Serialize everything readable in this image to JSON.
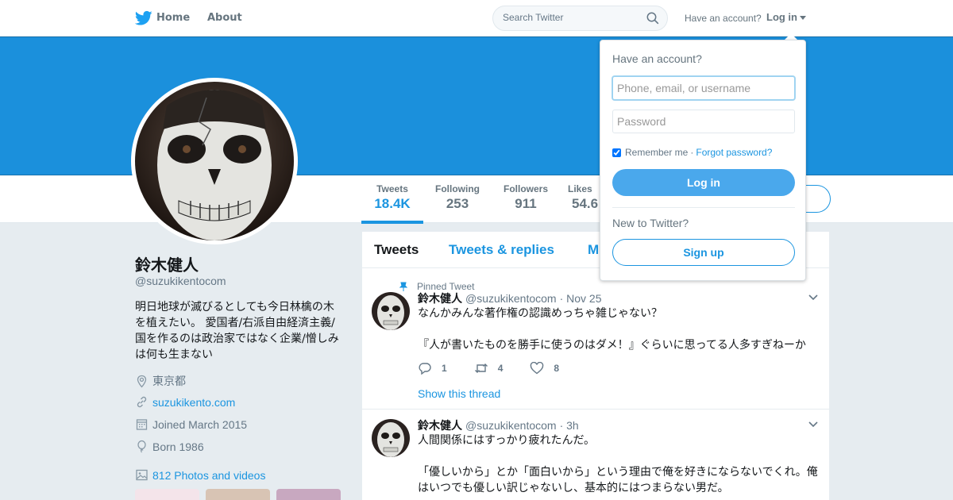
{
  "nav": {
    "home_label": "Home",
    "about_label": "About",
    "search_placeholder": "Search Twitter",
    "have_account": "Have an account?",
    "login_toggle": "Log in"
  },
  "profile": {
    "name": "鈴木健人",
    "handle": "@suzukikentocom",
    "bio": "明日地球が滅びるとしても今日林檎の木を植えたい。 愛国者/右派自由経済主義/国を作るのは政治家ではなく企業/憎しみは何も生まない",
    "location": "東京都",
    "website": "suzukikento.com",
    "joined": "Joined March 2015",
    "born": "Born 1986",
    "photos": "812 Photos and videos"
  },
  "stats": [
    {
      "label": "Tweets",
      "value": "18.4K"
    },
    {
      "label": "Following",
      "value": "253"
    },
    {
      "label": "Followers",
      "value": "911"
    },
    {
      "label": "Likes",
      "value": "54.6"
    }
  ],
  "timeline": {
    "tabs": [
      "Tweets",
      "Tweets & replies",
      "M"
    ],
    "pinned_label": "Pinned Tweet",
    "show_thread": "Show this thread",
    "tweets": [
      {
        "name": "鈴木健人",
        "handle": "@suzukikentocom",
        "time": "· Nov 25",
        "line1": "なんかみんな著作権の認識めっちゃ雑じゃない？",
        "line2": "『人が書いたものを勝手に使うのはダメ！』ぐらいに思ってる人多すぎねーか",
        "replies": "1",
        "retweets": "4",
        "likes": "8"
      },
      {
        "name": "鈴木健人",
        "handle": "@suzukikentocom",
        "time": "· 3h",
        "line1": "人間関係にはすっかり疲れたんだ。",
        "line2": "「優しいから」とか「面白いから」という理由で俺を好きにならないでくれ。俺はいつでも優しい訳じゃないし、基本的にはつまらない男だ。"
      }
    ]
  },
  "login": {
    "title": "Have an account?",
    "username_placeholder": "Phone, email, or username",
    "password_placeholder": "Password",
    "remember": "Remember me",
    "forgot": "Forgot password?",
    "login_button": "Log in",
    "new_label": "New to Twitter?",
    "signup_button": "Sign up"
  },
  "colors": {
    "brand": "#1b95e0",
    "banner": "#1b90dc"
  }
}
